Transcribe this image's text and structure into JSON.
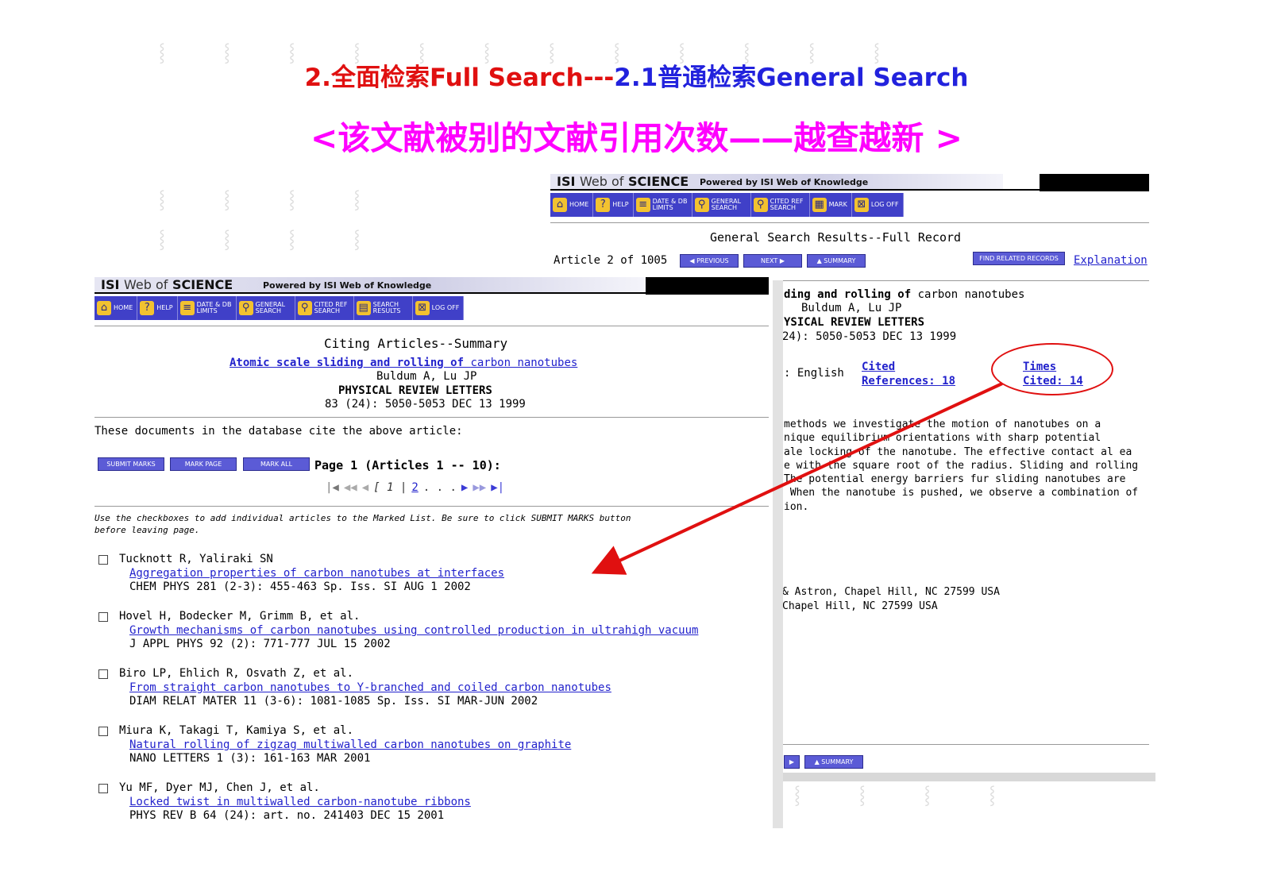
{
  "slide": {
    "title_red": "2.全面检索Full Search---",
    "title_blue": "2.1普通检索General Search",
    "subtitle": "<该文献被别的文献引用次数——越查越新 >"
  },
  "isi": {
    "logo_isi": "ISI",
    "logo_wos": "Web of",
    "logo_science": "SCIENCE",
    "powered": "Powered by ISI Web of Knowledge"
  },
  "right_window": {
    "toolbar": [
      {
        "icon": "home-icon",
        "label": "HOME",
        "glyph": "⌂"
      },
      {
        "icon": "help-icon",
        "label": "HELP",
        "glyph": "?"
      },
      {
        "icon": "database-icon",
        "label": "DATE & DB LIMITS",
        "glyph": "≡"
      },
      {
        "icon": "search-icon",
        "label": "GENERAL SEARCH",
        "glyph": "⚲"
      },
      {
        "icon": "cited-search-icon",
        "label": "CITED REF SEARCH",
        "glyph": "⚲"
      },
      {
        "icon": "mark-icon",
        "label": "MARK",
        "glyph": "▦"
      },
      {
        "icon": "logoff-icon",
        "label": "LOG OFF",
        "glyph": "⊠"
      }
    ],
    "page_title": "General Search Results--Full Record",
    "article_position": "Article 2 of 1005",
    "previous": "PREVIOUS",
    "next": "NEXT",
    "summary": "SUMMARY",
    "find_related": "FIND RELATED RECORDS",
    "explanation": "Explanation",
    "title_frag_bold": "ding and rolling of",
    "title_frag_rest": "carbon nanotubes",
    "authors_frag": "Buldum A, Lu JP",
    "journal_frag": "YSICAL REVIEW LETTERS",
    "pages_frag": "24): 5050-5053 DEC 13 1999",
    "language_frag": ": English",
    "cited_refs_label": "Cited",
    "cited_refs_value": "References: 18",
    "times_cited_label": "Times",
    "times_cited_value": "Cited: 14",
    "abstract_lines": [
      "methods we investigate the motion of nanotubes on a",
      "nique equilibrium orientations with sharp potential",
      "ale locking of the nanotube. The effective contact al ea",
      "e with the square root of the radius. Sliding and rolling",
      "The potential energy barriers fur sliding nanotubes are",
      " When the nanotube is pushed, we observe a combination of",
      "ion."
    ],
    "address_lines": [
      "& Astron, Chapel Hill, NC 27599 USA",
      "Chapel Hill, NC 27599 USA"
    ],
    "summary_bottom": "SUMMARY"
  },
  "left_window": {
    "toolbar": [
      {
        "icon": "home-icon",
        "label": "HOME",
        "glyph": "⌂"
      },
      {
        "icon": "help-icon",
        "label": "HELP",
        "glyph": "?"
      },
      {
        "icon": "database-icon",
        "label": "DATE & DB LIMITS",
        "glyph": "≡"
      },
      {
        "icon": "search-icon",
        "label": "GENERAL SEARCH",
        "glyph": "⚲"
      },
      {
        "icon": "cited-search-icon",
        "label": "CITED REF SEARCH",
        "glyph": "⚲"
      },
      {
        "icon": "results-icon",
        "label": "SEARCH RESULTS",
        "glyph": "▤"
      },
      {
        "icon": "logoff-icon",
        "label": "LOG OFF",
        "glyph": "⊠"
      }
    ],
    "page_title": "Citing Articles--Summary",
    "cited_article_title_bold": "Atomic scale sliding and rolling of",
    "cited_article_title_rest": "carbon nanotubes",
    "cited_article_authors": "Buldum A, Lu JP",
    "cited_article_journal": "PHYSICAL REVIEW LETTERS",
    "cited_article_pages": "83 (24): 5050-5053 DEC 13 1999",
    "intro": "These documents in the database cite the above article:",
    "submit_marks": "SUBMIT MARKS",
    "mark_page": "MARK PAGE",
    "mark_all": "MARK ALL",
    "page_info": "Page 1 (Articles 1 -- 10):",
    "pager_current": "1",
    "pager_next": "2",
    "pager_ellipsis": ". . .",
    "instructions_1": "Use the checkboxes to add individual articles to the Marked List. Be sure to click SUBMIT MARKS button",
    "instructions_2": "before leaving page.",
    "results": [
      {
        "authors": "Tucknott R, Yaliraki SN",
        "title": "Aggregation properties of carbon nanotubes at interfaces",
        "source": "CHEM PHYS 281 (2-3): 455-463 Sp. Iss. SI AUG 1 2002"
      },
      {
        "authors": "Hovel H, Bodecker M, Grimm B, et al.",
        "title": "Growth mechanisms of carbon nanotubes using controlled production in ultrahigh vacuum",
        "source": "J APPL PHYS 92 (2): 771-777 JUL 15 2002"
      },
      {
        "authors": "Biro LP, Ehlich R, Osvath Z, et al.",
        "title": "From straight carbon nanotubes to Y-branched and coiled carbon nanotubes",
        "source": "DIAM RELAT MATER 11 (3-6): 1081-1085 Sp. Iss. SI MAR-JUN 2002"
      },
      {
        "authors": "Miura K, Takagi T, Kamiya S, et al.",
        "title": "Natural rolling of zigzag multiwalled carbon nanotubes on graphite",
        "source": "NANO LETTERS 1 (3): 161-163 MAR 2001"
      },
      {
        "authors": "Yu MF, Dyer MJ, Chen J, et al.",
        "title": "Locked twist in multiwalled carbon-nanotube ribbons",
        "source": "PHYS REV B 64 (24): art. no. 241403 DEC 15 2001"
      }
    ]
  },
  "colors": {
    "title_red": "#e01010",
    "title_blue": "#2222dd",
    "subtitle": "#ff00ff",
    "annotation": "#e01010",
    "link": "#2222cc",
    "toolbar": "#3a3ac0"
  }
}
